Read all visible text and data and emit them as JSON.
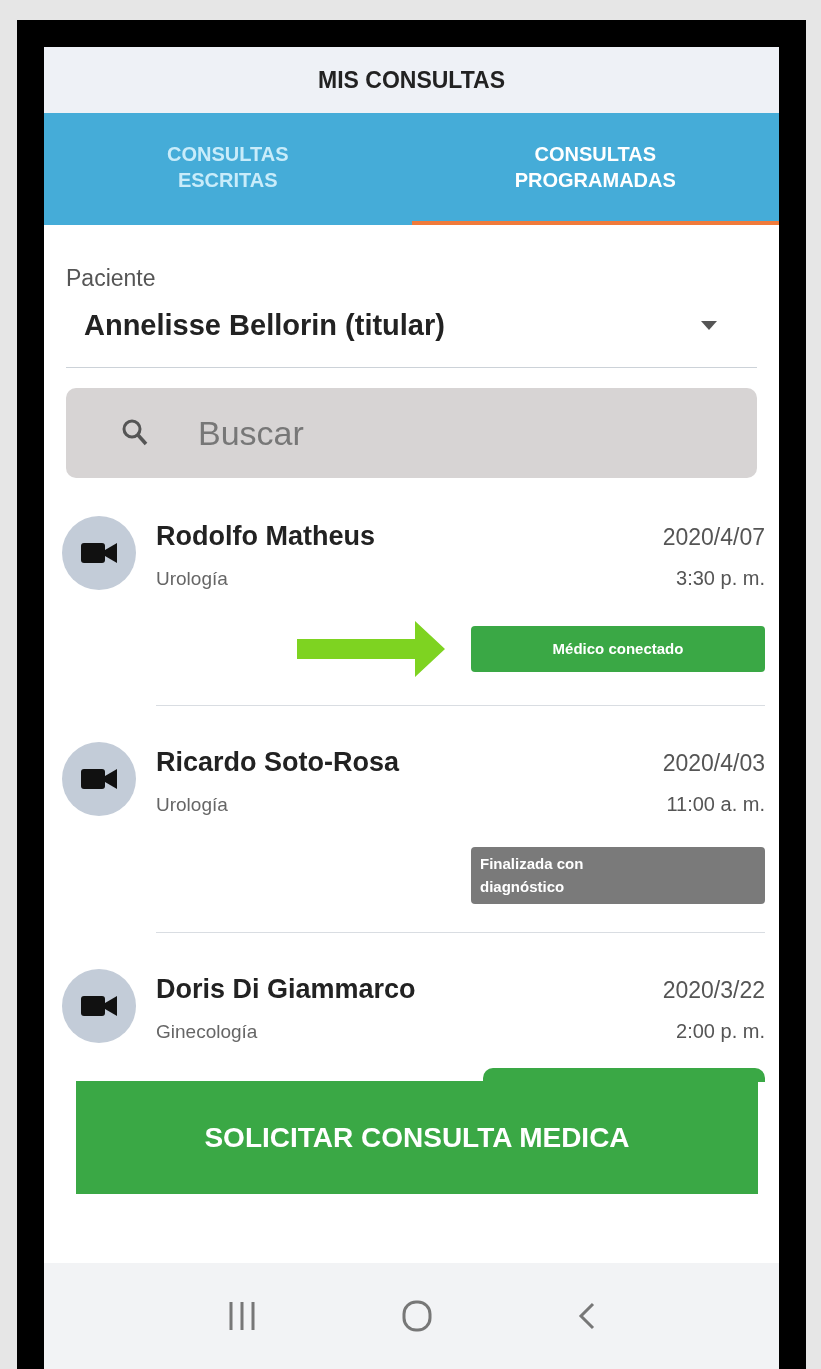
{
  "header": {
    "title": "MIS CONSULTAS"
  },
  "tabs": [
    {
      "label": "CONSULTAS ESCRITAS",
      "selected": false
    },
    {
      "label": "CONSULTAS PROGRAMADAS",
      "selected": true
    }
  ],
  "patient": {
    "label": "Paciente",
    "value": "Annelisse Bellorin (titular)"
  },
  "search": {
    "placeholder": "Buscar"
  },
  "consultations": [
    {
      "doctor": "Rodolfo Matheus",
      "specialty": "Urología",
      "date": "2020/4/07",
      "time": "3:30 p. m.",
      "status": {
        "kind": "connected",
        "label": "Médico conectado"
      },
      "highlighted": true
    },
    {
      "doctor": "Ricardo Soto-Rosa",
      "specialty": "Urología",
      "date": "2020/4/03",
      "time": "11:00 a. m.",
      "status": {
        "kind": "finished",
        "label": "Finalizada con diagnóstico"
      },
      "highlighted": false
    },
    {
      "doctor": "Doris Di Giammarco",
      "specialty": "Ginecología",
      "date": "2020/3/22",
      "time": "2:00 p. m.",
      "status": {
        "kind": "connected"
      }
    }
  ],
  "action_button": "SOLICITAR CONSULTA MEDICA"
}
